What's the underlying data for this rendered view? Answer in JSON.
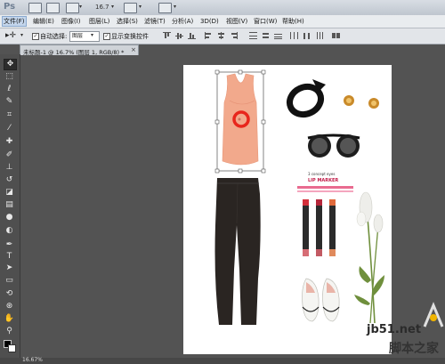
{
  "app": {
    "logo": "Ps",
    "zoom_display": "16.7",
    "caret": "▾"
  },
  "menu": [
    "文件(F)",
    "编辑(E)",
    "图像(I)",
    "图层(L)",
    "选择(S)",
    "滤镜(T)",
    "分析(A)",
    "3D(D)",
    "视图(V)",
    "窗口(W)",
    "帮助(H)"
  ],
  "options": {
    "auto_select_label": "自动选择:",
    "auto_select_value": "图层",
    "show_transform_label": "显示变换控件"
  },
  "document": {
    "tab_title": "未标题-1 @ 16.7% (图层 1, RGB/8) *",
    "close": "×"
  },
  "status": {
    "zoom": "16.67%"
  },
  "canvas_items": {
    "lipstick_brand": "3 concept eyes",
    "lipstick_title": "LIP MARKER"
  },
  "watermark": {
    "line1": "jb51.net",
    "line2": "脚本之家"
  },
  "colors": {
    "top": "#f2a98c",
    "selection_marker": "#e8261c",
    "jeans": "#2a2522",
    "accessories": "#111111"
  },
  "tools": [
    "move-tool",
    "marquee-tool",
    "lasso-tool",
    "quick-select-tool",
    "crop-tool",
    "eyedropper-tool",
    "healing-tool",
    "brush-tool",
    "stamp-tool",
    "history-brush-tool",
    "eraser-tool",
    "gradient-tool",
    "blur-tool",
    "dodge-tool",
    "pen-tool",
    "type-tool",
    "path-select-tool",
    "shape-tool",
    "3d-rotate-tool",
    "3d-orbit-tool",
    "hand-tool",
    "zoom-tool"
  ]
}
